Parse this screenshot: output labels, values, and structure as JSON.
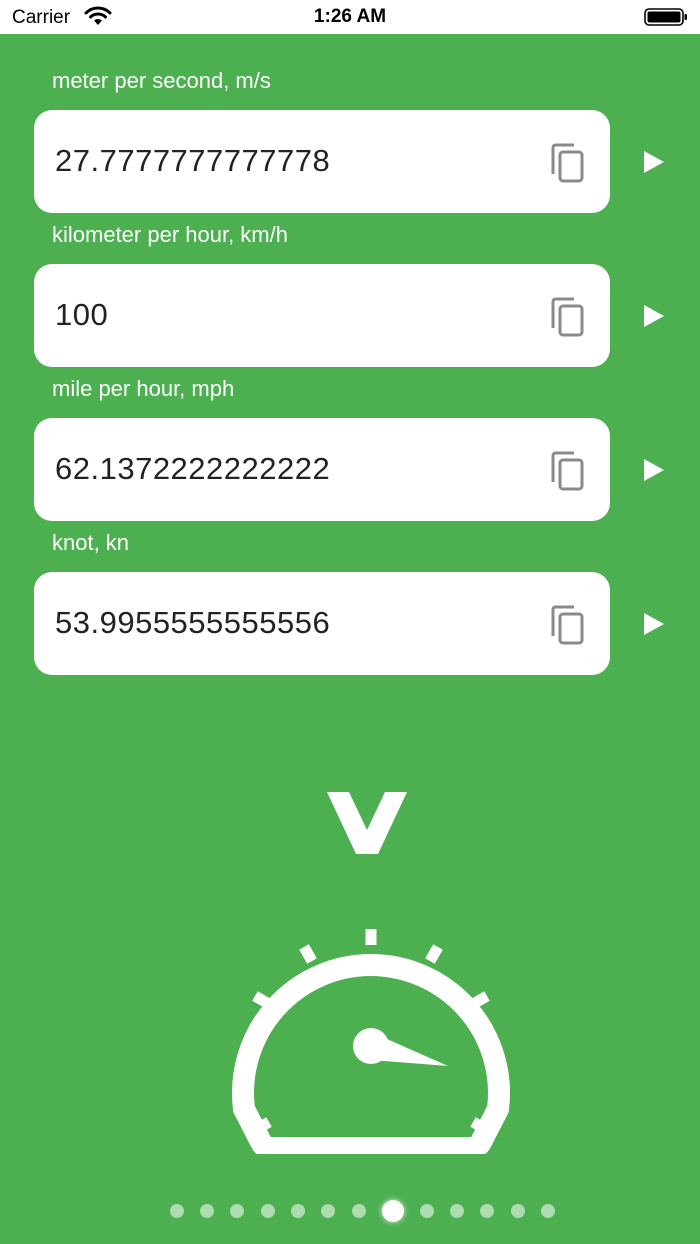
{
  "status_bar": {
    "carrier": "Carrier",
    "time": "1:26 AM"
  },
  "fields": [
    {
      "label": "meter per second, m/s",
      "value": "27.7777777777778"
    },
    {
      "label": "kilometer per hour, km/h",
      "value": "100"
    },
    {
      "label": "mile per hour, mph",
      "value": "62.1372222222222"
    },
    {
      "label": "knot, kn",
      "value": "53.9955555555556"
    }
  ],
  "icons": {
    "copy": "copy-icon",
    "play": "play-icon",
    "category": "velocity-v-icon",
    "illustration": "speedometer-icon"
  },
  "colors": {
    "background": "#4caf50",
    "field": "#ffffff",
    "text": "#222222",
    "icon_gray": "#8a8a8a"
  },
  "pager": {
    "total": 13,
    "active_index": 7
  }
}
